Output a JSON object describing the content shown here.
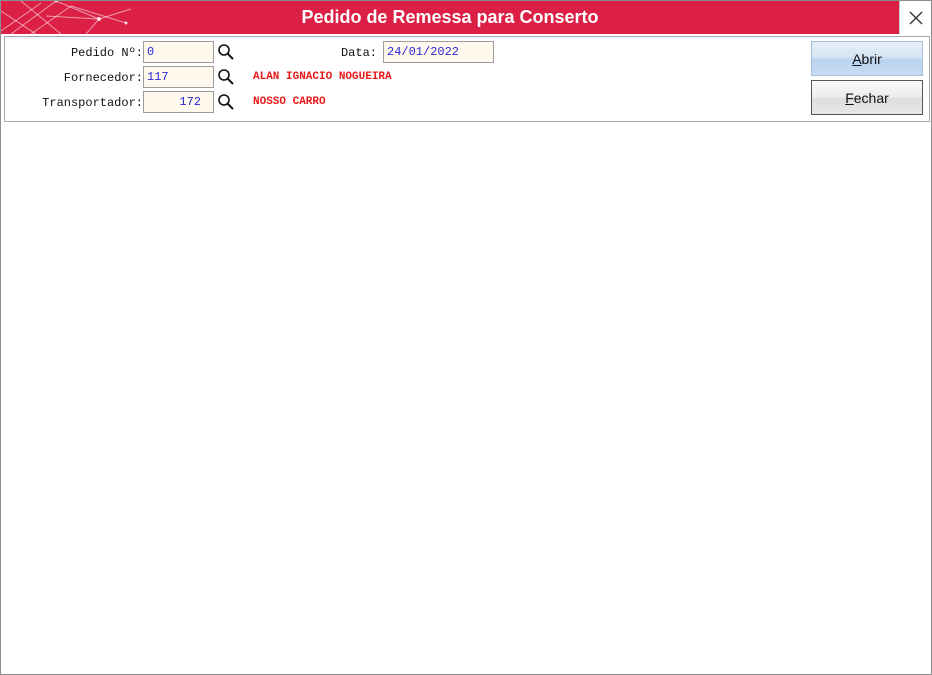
{
  "window": {
    "title": "Pedido de Remessa para Conserto"
  },
  "form": {
    "pedido_label": "Pedido Nº:",
    "pedido_value": "0",
    "data_label": "Data:",
    "data_value": "24/01/2022",
    "fornecedor_label": "Fornecedor:",
    "fornecedor_value": "117",
    "fornecedor_name": "ALAN IGNACIO NOGUEIRA",
    "transportador_label": "Transportador:",
    "transportador_value": "172",
    "transportador_name": "NOSSO CARRO"
  },
  "buttons": {
    "abrir_first": "A",
    "abrir_rest": "brir",
    "fechar_first": "F",
    "fechar_rest": "echar"
  },
  "icons": {
    "lookup": "magnifier-icon",
    "close": "close-icon"
  },
  "colors": {
    "titlebar": "#dc1f45",
    "field_text": "#2a2ad6",
    "info_text": "#e81818",
    "field_bg": "#fff8ec"
  }
}
